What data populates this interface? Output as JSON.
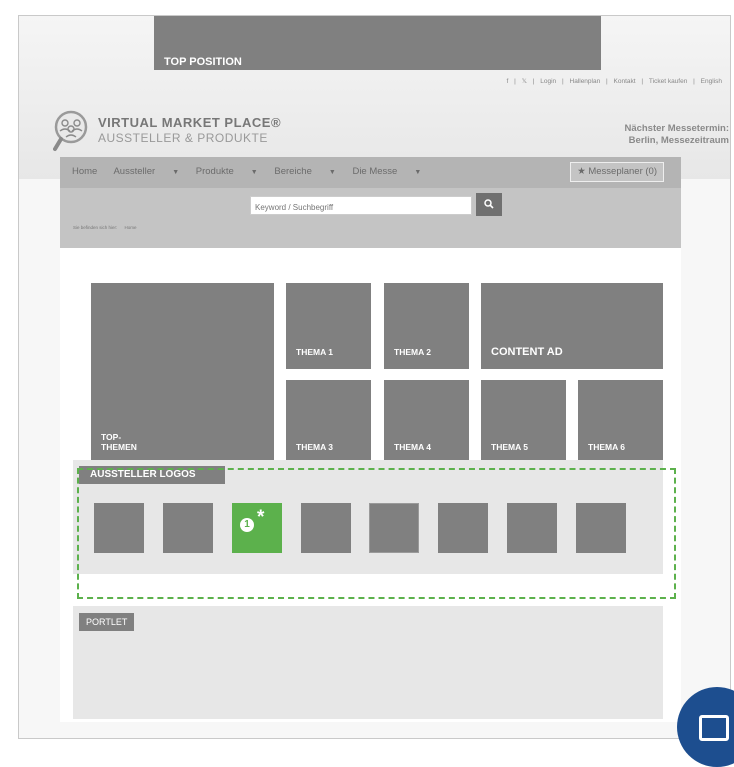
{
  "top_position": {
    "label": "TOP POSITION"
  },
  "utility_links": [
    "f",
    "|",
    "𝕏",
    "|",
    "Login",
    "|",
    "Hallenplan",
    "|",
    "Kontakt",
    "|",
    "Ticket kaufen",
    "|",
    "English"
  ],
  "brand": {
    "title": "VIRTUAL MARKET PLACE®",
    "subtitle": "AUSSTELLER & PRODUKTE",
    "logo_icon": "people-magnifier-icon"
  },
  "next_fair": {
    "line1": "Nächster Messetermin:",
    "line2": "Berlin, Messezeitraum"
  },
  "nav": {
    "items": [
      {
        "label": "Home",
        "dropdown": false
      },
      {
        "label": "Aussteller",
        "dropdown": true
      },
      {
        "label": "Produkte",
        "dropdown": true
      },
      {
        "label": "Bereiche",
        "dropdown": true
      },
      {
        "label": "Die Messe",
        "dropdown": true
      }
    ],
    "caret": "▼",
    "planer": "Messeplaner (0)",
    "planer_icon": "★"
  },
  "search": {
    "placeholder": "Keyword / Suchbegriff",
    "button_icon": "🔍"
  },
  "breadcrumb": {
    "prefix": "Sie befinden sich hier:",
    "current": "Home"
  },
  "tiles": {
    "top_themen": "TOP-\nTHEMEN",
    "thema1": "THEMA 1",
    "thema2": "THEMA 2",
    "content_ad": "CONTENT AD",
    "thema3": "THEMA 3",
    "thema4": "THEMA 4",
    "thema5": "THEMA 5",
    "thema6": "THEMA 6"
  },
  "logos": {
    "header": "AUSSTELLER LOGOS",
    "highlight_number": "1",
    "highlight_mark": "*",
    "highlight_color": "#5cb14c"
  },
  "portlet": {
    "label": "PORTLET"
  },
  "colors": {
    "placeholder_gray": "#808080",
    "accent_green": "#5cb14c",
    "corner_blue": "#1d4e8f"
  }
}
